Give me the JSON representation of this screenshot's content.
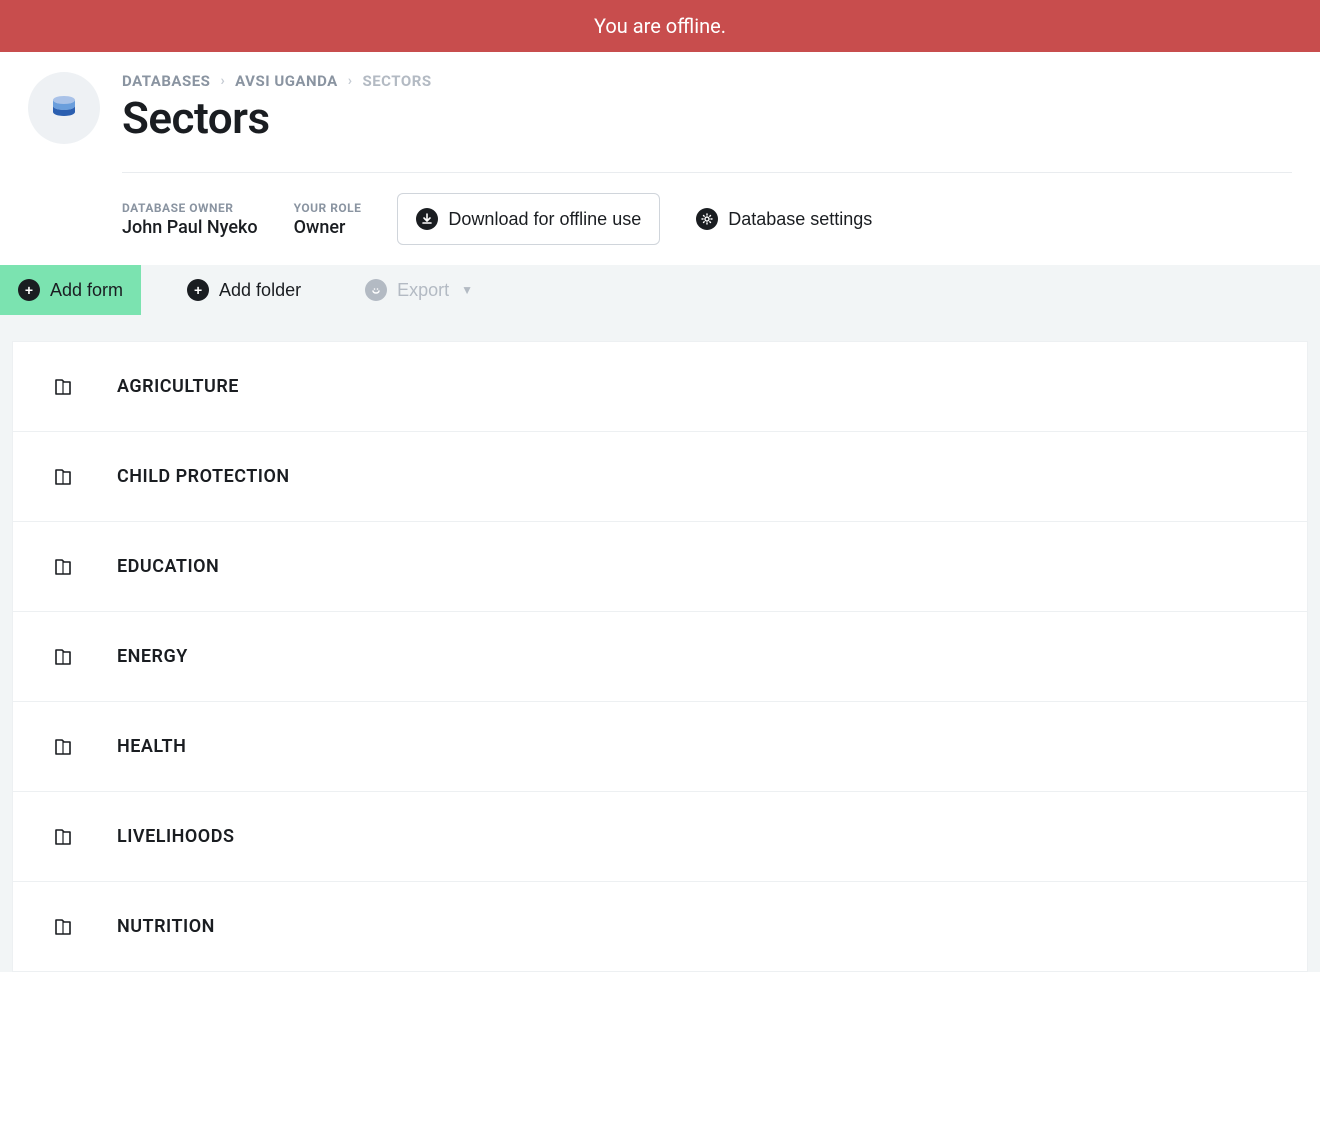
{
  "banner": {
    "offline_text": "You are offline."
  },
  "breadcrumb": {
    "items": [
      {
        "label": "DATABASES"
      },
      {
        "label": "AVSI UGANDA"
      },
      {
        "label": "SECTORS"
      }
    ]
  },
  "page": {
    "title": "Sectors"
  },
  "meta": {
    "owner_label": "DATABASE OWNER",
    "owner_value": "John Paul Nyeko",
    "role_label": "YOUR ROLE",
    "role_value": "Owner"
  },
  "actions": {
    "download_label": "Download for offline use",
    "settings_label": "Database settings"
  },
  "toolbar": {
    "add_form_label": "Add form",
    "add_folder_label": "Add folder",
    "export_label": "Export"
  },
  "folders": [
    {
      "label": "AGRICULTURE"
    },
    {
      "label": "CHILD PROTECTION"
    },
    {
      "label": "EDUCATION"
    },
    {
      "label": "ENERGY"
    },
    {
      "label": "HEALTH"
    },
    {
      "label": "LIVELIHOODS"
    },
    {
      "label": "NUTRITION"
    }
  ]
}
